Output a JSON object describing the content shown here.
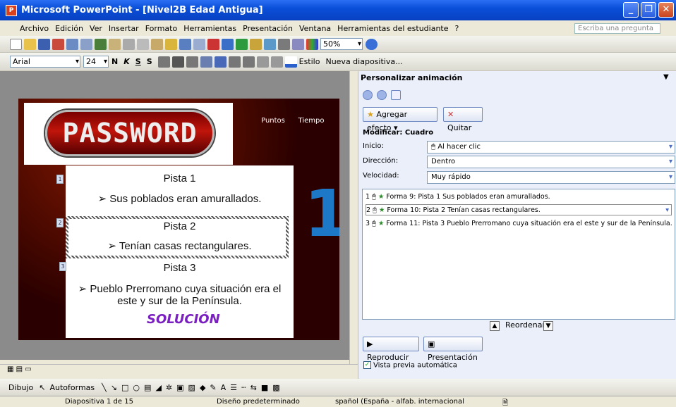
{
  "window": {
    "title": "Microsoft PowerPoint - [Nivel2B Edad Antigua]"
  },
  "menu": {
    "items": [
      "Archivo",
      "Edición",
      "Ver",
      "Insertar",
      "Formato",
      "Herramientas",
      "Presentación",
      "Ventana",
      "Herramientas del estudiante",
      "?"
    ],
    "ask_placeholder": "Escriba una pregunta"
  },
  "toolbar": {
    "zoom": "50%",
    "font": "Arial",
    "font_size": "24",
    "bold": "N",
    "italic": "K",
    "underline": "S",
    "shadow": "S",
    "design_label": "Estilo",
    "new_slide_label": "Nueva diapositiva..."
  },
  "slide": {
    "logo_text": "PASSWORD",
    "puntos": "Puntos",
    "tiempo": "Tiempo",
    "big_number": "1",
    "clues": [
      {
        "num": "1",
        "title": "Pista 1",
        "text": "➢ Sus poblados eran amurallados."
      },
      {
        "num": "2",
        "title": "Pista 2",
        "text": "➢ Tenían casas rectangulares."
      },
      {
        "num": "3",
        "title": "Pista 3",
        "text": "➢ Pueblo Prerromano cuya situación era el",
        "text2": "este y sur de la Península."
      }
    ],
    "solution": "SOLUCIÓN"
  },
  "pane": {
    "title": "Personalizar animación",
    "add_effect": "Agregar efecto",
    "remove": "Quitar",
    "modify": "Modificar: Cuadro",
    "start_label": "Inicio:",
    "start_value": "Al hacer clic",
    "direction_label": "Dirección:",
    "direction_value": "Dentro",
    "speed_label": "Velocidad:",
    "speed_value": "Muy rápido",
    "animations": [
      {
        "num": "1",
        "text": "Forma 9: Pista 1  Sus poblados eran amurallados."
      },
      {
        "num": "2",
        "text": "Forma 10: Pista 2  Tenían casas rectangulares."
      },
      {
        "num": "3",
        "text": "Forma 11: Pista 3  Pueblo Prerromano cuya situación era el este y sur de la Península."
      }
    ],
    "reorder": "Reordenar",
    "play": "Reproducir",
    "slideshow": "Presentación",
    "preview": "Vista previa automática"
  },
  "drawing": {
    "draw": "Dibujo",
    "autoshapes": "Autoformas"
  },
  "status": {
    "slide": "Diapositiva 1 de 15",
    "design": "Diseño predeterminado",
    "language": "spañol (España - alfab. internacional"
  },
  "colors": {
    "titlebar": "#0a4fd8",
    "accent_number": "#1e78c8",
    "solution": "#7b20c0"
  }
}
